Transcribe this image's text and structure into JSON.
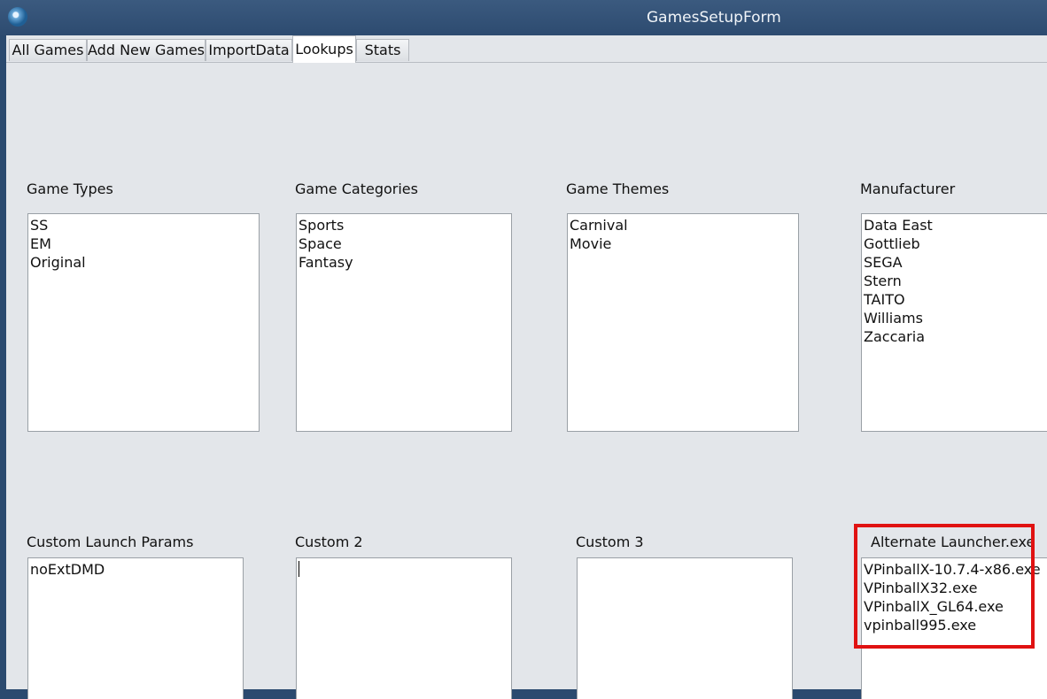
{
  "window": {
    "title": "GamesSetupForm"
  },
  "tabs": [
    {
      "label": "All Games"
    },
    {
      "label": "Add New Games"
    },
    {
      "label": "ImportData"
    },
    {
      "label": "Lookups"
    },
    {
      "label": "Stats"
    }
  ],
  "active_tab": "Lookups",
  "lookups": {
    "game_types": {
      "label": "Game Types",
      "items": [
        "SS",
        "EM",
        "Original"
      ]
    },
    "game_categories": {
      "label": "Game Categories",
      "items": [
        "Sports",
        "Space",
        "Fantasy"
      ]
    },
    "game_themes": {
      "label": "Game Themes",
      "items": [
        "Carnival",
        "Movie"
      ]
    },
    "manufacturer": {
      "label": "Manufacturer",
      "items": [
        "Data East",
        "Gottlieb",
        "SEGA",
        "Stern",
        "TAITO",
        "Williams",
        "Zaccaria"
      ]
    },
    "custom_launch_params": {
      "label": "Custom Launch Params",
      "items": [
        "noExtDMD"
      ]
    },
    "custom2": {
      "label": "Custom 2",
      "items": []
    },
    "custom3": {
      "label": "Custom 3",
      "items": []
    },
    "alternate_launcher": {
      "label": "Alternate Launcher.exe",
      "items": [
        "VPinballX-10.7.4-x86.exe",
        "VPinballX32.exe",
        "VPinballX_GL64.exe",
        "vpinball995.exe"
      ]
    }
  },
  "colors": {
    "highlight": "#e01212",
    "background": "#e3e6ea"
  }
}
